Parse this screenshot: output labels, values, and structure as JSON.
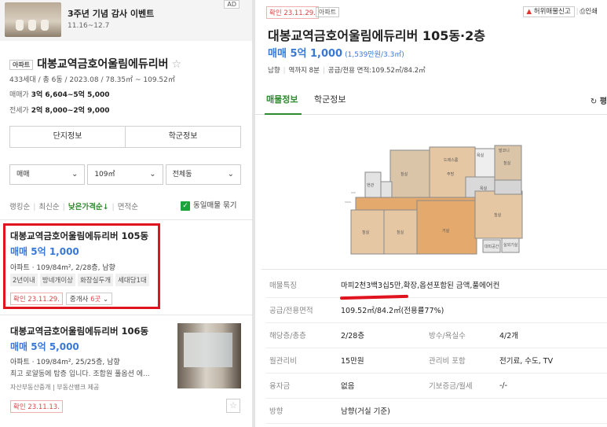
{
  "banner": {
    "title": "3주년 기념 감사 이벤트",
    "dates": "11.16~12.7",
    "ad_label": "AD"
  },
  "complex": {
    "type_tag": "아파트",
    "name": "대봉교역금호어울림에듀리버",
    "info": "433세대 / 총 6동 / 2023.08 / 78.35㎡ ~ 109.52㎡",
    "sale_label": "매매가",
    "sale_value": "3억 6,604~5억 5,000",
    "lease_label": "전세가",
    "lease_value": "2억 8,000~2억 9,000",
    "btn_complex": "단지정보",
    "btn_school": "학군정보"
  },
  "filters": [
    {
      "label": "매매"
    },
    {
      "label": "109㎡"
    },
    {
      "label": "전체동"
    }
  ],
  "sort": {
    "items": [
      "랭킹순",
      "최신순",
      "낮은가격순↓",
      "면적순"
    ],
    "same_listing": "동일매물 묶기"
  },
  "listings": [
    {
      "name": "대봉교역금호어울림에듀리버 105동",
      "price": "매매 5억 1,000",
      "spec": "아파트 · 109/84m², 2/28층, 남향",
      "features": [
        "2년이내",
        "방네개이상",
        "화장실두개",
        "세대당1대"
      ],
      "confirm": "확인 23.11.29.",
      "agents_label": "중개사",
      "agents_count": "6곳"
    },
    {
      "name": "대봉교역금호어울림에듀리버 106동",
      "price": "매매 5억 5,000",
      "spec": "아파트 · 109/84m², 25/25층, 남향",
      "desc": "최고 로얄동에 탑층 입니다. 조합원 풀옵션 에...",
      "agency": "자산부동산중개 | 부동산뱅크 제공",
      "confirm": "확인 23.11.13."
    }
  ],
  "detail": {
    "confirm": "확인 23.11.29.",
    "type_tag": "아파트",
    "report": "허위매물신고",
    "print": "인쇄",
    "title": "대봉교역금호어울림에듀리버 105동·2층",
    "price": "매매 5억 1,000",
    "price_per": "(1,539만원/3.3㎡)",
    "meta": [
      "남향",
      "역까지 8분",
      "공급/전용 면적:109.52㎡/84.2㎡"
    ],
    "tabs": [
      "매물정보",
      "학군정보"
    ],
    "refresh": "평",
    "rows": [
      {
        "k": "매물특징",
        "v": "마피2천3백3십5만,확장,옵션포함된 금액,풀에어컨"
      },
      {
        "k": "공급/전용면적",
        "v": "109.52㎡/84.2㎡(전용률77%)"
      },
      {
        "k": "해당층/총층",
        "v": "2/28층",
        "k2": "방수/욕실수",
        "v2": "4/2개"
      },
      {
        "k": "월관리비",
        "v": "15만원",
        "k2": "관리비 포함",
        "v2": "전기료, 수도, TV"
      },
      {
        "k": "융자금",
        "v": "없음",
        "k2": "기보증금/월세",
        "v2": "-/-"
      },
      {
        "k": "방향",
        "v": "남향(거실 기준)"
      }
    ]
  },
  "floorplan": {
    "rooms": [
      "침실",
      "드레스룸",
      "욕실",
      "발코니",
      "현관",
      "침실",
      "욕실",
      "거실",
      "침실",
      "침실",
      "주방",
      "침실",
      "대피공간",
      "실외기실"
    ]
  }
}
